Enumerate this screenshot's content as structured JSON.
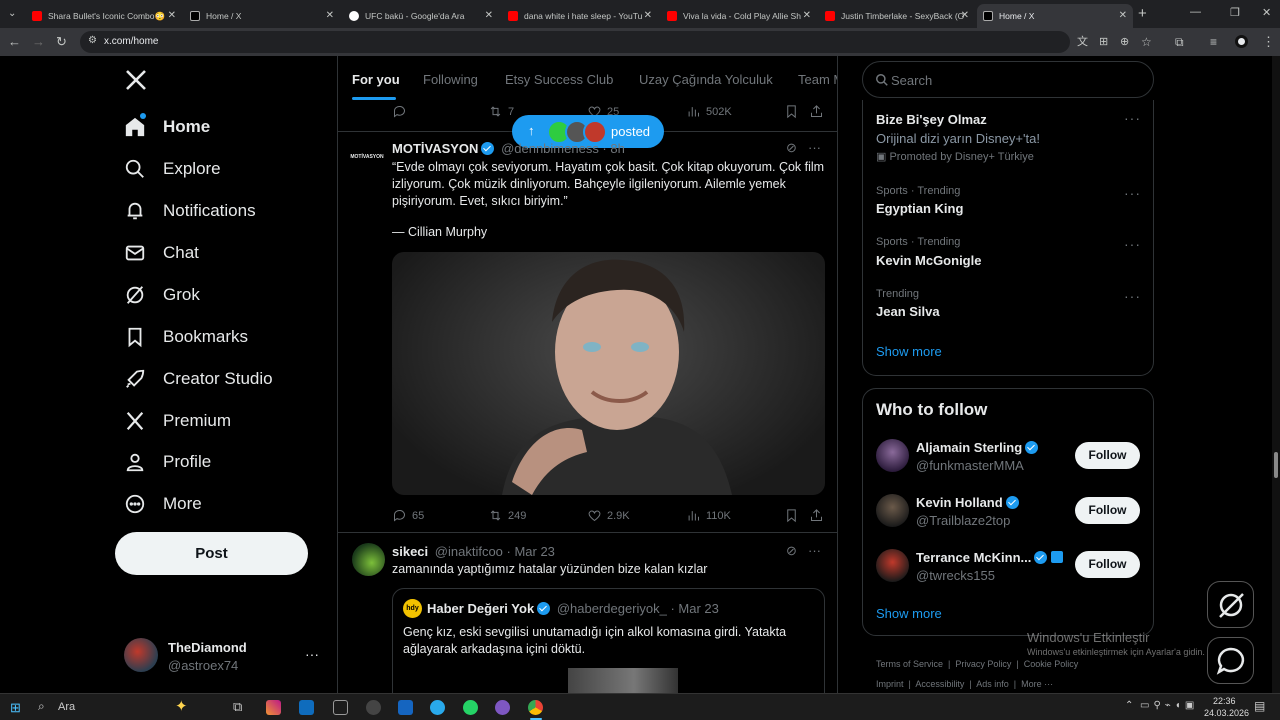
{
  "browser": {
    "tabs": [
      {
        "title": "Shara Bullet's Iconic Combo😳",
        "color": "#ff0000"
      },
      {
        "title": "Home / X",
        "color": "#ffffff"
      },
      {
        "title": "UFC bakü - Google'da Ara",
        "color": "#4285f4"
      },
      {
        "title": "dana white i hate sleep - YouTu",
        "color": "#ff0000"
      },
      {
        "title": "Viva la vida - Cold Play Allie Sh",
        "color": "#ff0000"
      },
      {
        "title": "Justin Timberlake - SexyBack (O",
        "color": "#ff0000"
      },
      {
        "title": "Home / X",
        "color": "#ffffff"
      }
    ],
    "new_tab": "+",
    "url": "x.com/home"
  },
  "sidebar": {
    "items": [
      {
        "label": "Home",
        "icon": "home-icon"
      },
      {
        "label": "Explore",
        "icon": "search-icon"
      },
      {
        "label": "Notifications",
        "icon": "bell-icon"
      },
      {
        "label": "Chat",
        "icon": "mail-icon"
      },
      {
        "label": "Grok",
        "icon": "grok-icon"
      },
      {
        "label": "Bookmarks",
        "icon": "bookmark-icon"
      },
      {
        "label": "Creator Studio",
        "icon": "rocket-icon"
      },
      {
        "label": "Premium",
        "icon": "x-icon"
      },
      {
        "label": "Profile",
        "icon": "person-icon"
      },
      {
        "label": "More",
        "icon": "more-circle-icon"
      }
    ],
    "post_label": "Post",
    "account": {
      "name": "TheDiamond",
      "handle": "@astroex74"
    }
  },
  "timeline": {
    "tabs": [
      "For you",
      "Following",
      "Etsy Success Club",
      "Uzay Çağında Yolculuk",
      "Team M"
    ],
    "posted_pill": "posted",
    "prev_actions": {
      "retweets": "7",
      "likes": "25",
      "views": "502K"
    },
    "tweet1": {
      "name": "MOTİVASYON",
      "handle": "@dennbimeness · 8h",
      "avatar_text": "MOTİVASYON",
      "text": "“Evde olmayı çok seviyorum. Hayatım çok basit. Çok kitap okuyorum. Çok film izliyorum. Çok müzik dinliyorum. Bahçeyle ilgileniyorum. Ailemle yemek pişiriyorum. Evet, sıkıcı biriyim.”",
      "quote": "— Cillian Murphy",
      "replies": "65",
      "retweets": "249",
      "likes": "2.9K",
      "views": "110K"
    },
    "tweet2": {
      "name": "sikeci",
      "handle": "@inaktifcoo · Mar 23",
      "text": "zamanında yaptığımız hatalar yüzünden bize kalan kızlar",
      "quoted": {
        "name": "Haber Değeri Yok",
        "handle": "@haberdegeriyok_ · Mar 23",
        "text": "Genç kız, eski sevgilisi unutamadığı için alkol komasına girdi. Yatakta ağlayarak arkadaşına içini döktü."
      }
    }
  },
  "right": {
    "search_placeholder": "Search",
    "promo": {
      "title": "Bize Bi'şey Olmaz",
      "desc": "Orijinal dizi yarın Disney+'ta!",
      "promoted": "Promoted by Disney+ Türkiye"
    },
    "trends": [
      {
        "meta": "Sports · Trending",
        "name": "Egyptian King"
      },
      {
        "meta": "Sports · Trending",
        "name": "Kevin McGonigle"
      },
      {
        "meta": "Trending",
        "name": "Jean Silva"
      }
    ],
    "show_more": "Show more",
    "who_to_follow": "Who to follow",
    "follow": [
      {
        "name": "Aljamain Sterling",
        "handle": "@funkmasterMMA"
      },
      {
        "name": "Kevin Holland",
        "handle": "@Trailblaze2top"
      },
      {
        "name": "Terrance McKinn...",
        "handle": "@twrecks155"
      }
    ],
    "follow_label": "Follow",
    "show_more2": "Show more",
    "footer": [
      "Terms of Service",
      "Privacy Policy",
      "Cookie Policy",
      "Imprint",
      "Accessibility",
      "Ads info",
      "More ···"
    ]
  },
  "watermark": {
    "title": "Windows'u Etkinleştir",
    "sub": "Windows'u etkinleştirmek için Ayarlar'a gidin."
  },
  "taskbar": {
    "search": "Ara",
    "time": "22:36",
    "date": "24.03.2026"
  }
}
